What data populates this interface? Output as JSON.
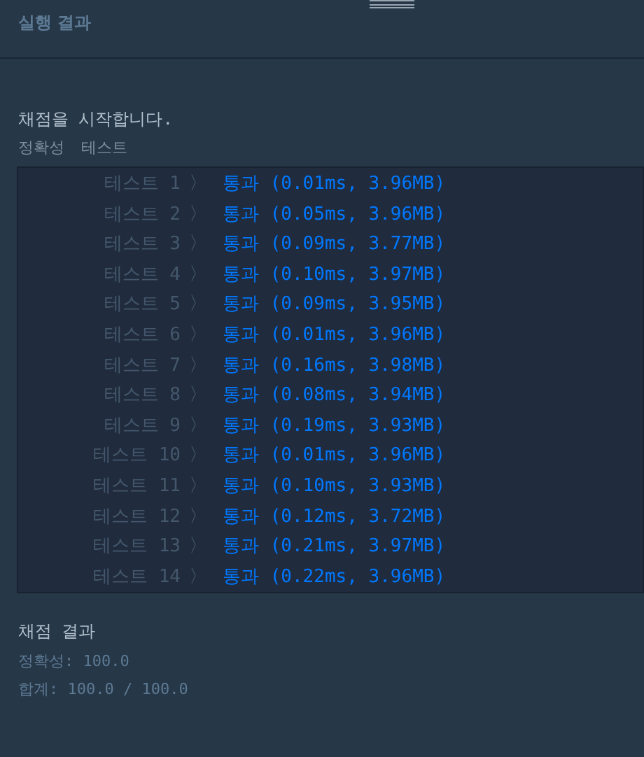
{
  "panel": {
    "title": "실행 결과"
  },
  "output": {
    "start_message": "채점을 시작합니다.",
    "section_labels": [
      "정확성",
      "테스트"
    ],
    "tests": [
      {
        "label": "테스트 1",
        "separator": "〉",
        "result": "통과",
        "detail": "(0.01ms, 3.96MB)"
      },
      {
        "label": "테스트 2",
        "separator": "〉",
        "result": "통과",
        "detail": "(0.05ms, 3.96MB)"
      },
      {
        "label": "테스트 3",
        "separator": "〉",
        "result": "통과",
        "detail": "(0.09ms, 3.77MB)"
      },
      {
        "label": "테스트 4",
        "separator": "〉",
        "result": "통과",
        "detail": "(0.10ms, 3.97MB)"
      },
      {
        "label": "테스트 5",
        "separator": "〉",
        "result": "통과",
        "detail": "(0.09ms, 3.95MB)"
      },
      {
        "label": "테스트 6",
        "separator": "〉",
        "result": "통과",
        "detail": "(0.01ms, 3.96MB)"
      },
      {
        "label": "테스트 7",
        "separator": "〉",
        "result": "통과",
        "detail": "(0.16ms, 3.98MB)"
      },
      {
        "label": "테스트 8",
        "separator": "〉",
        "result": "통과",
        "detail": "(0.08ms, 3.94MB)"
      },
      {
        "label": "테스트 9",
        "separator": "〉",
        "result": "통과",
        "detail": "(0.19ms, 3.93MB)"
      },
      {
        "label": "테스트 10",
        "separator": "〉",
        "result": "통과",
        "detail": "(0.01ms, 3.96MB)"
      },
      {
        "label": "테스트 11",
        "separator": "〉",
        "result": "통과",
        "detail": "(0.10ms, 3.93MB)"
      },
      {
        "label": "테스트 12",
        "separator": "〉",
        "result": "통과",
        "detail": "(0.12ms, 3.72MB)"
      },
      {
        "label": "테스트 13",
        "separator": "〉",
        "result": "통과",
        "detail": "(0.21ms, 3.97MB)"
      },
      {
        "label": "테스트 14",
        "separator": "〉",
        "result": "통과",
        "detail": "(0.22ms, 3.96MB)"
      }
    ],
    "summary_title": "채점 결과",
    "summary_lines": [
      "정확성: 100.0",
      "합계: 100.0 / 100.0"
    ]
  }
}
